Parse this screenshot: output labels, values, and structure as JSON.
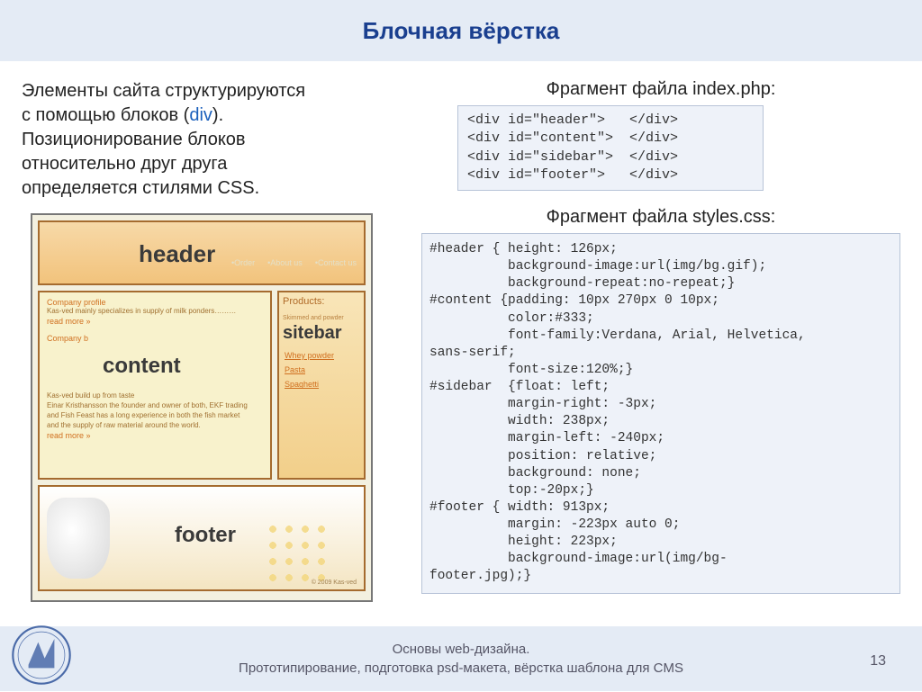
{
  "title": "Блочная вёрстка",
  "intro": {
    "line1": "Элементы сайта структурируются",
    "line2a": "с помощью блоков (",
    "div_word": "div",
    "line2b": ").",
    "line3": "Позиционирование блоков",
    "line4": "относительно друг друга",
    "line5": "определяется стилями CSS."
  },
  "mock": {
    "header_label": "header",
    "nav": [
      "•Order",
      "•About us",
      "•Contact us"
    ],
    "content_label": "content",
    "content_texts": {
      "cp": "Company profile",
      "l1": "Kas-ved mainly specializes in supply of milk ponders………",
      "rm": "read more »",
      "cb": "Company b",
      "l2": "Kas-ved build up from taste",
      "l3": "Einar Kristhansson the founder and owner of both, EKF trading",
      "l4": "and Fish Feast has a long experience in both the fish market",
      "l5": "and the supply of raw material around the world.",
      "rm2": "read more »"
    },
    "sidebar_label": "sitebar",
    "sidebar_title": "Products:",
    "sidebar_sub": "Skimmed and powder",
    "sidebar_links": [
      "Whey powder",
      "Pasta",
      "Spaghetti"
    ],
    "footer_label": "footer",
    "copyright": "© 2009 Kas-ved"
  },
  "php_caption": "Фрагмент файла index.php:",
  "php_code": "<div id=\"header\">   </div>\n<div id=\"content\">  </div>\n<div id=\"sidebar\">  </div>\n<div id=\"footer\">   </div>",
  "css_caption": "Фрагмент файла styles.css:",
  "css_code": "#header { height: 126px;\n          background-image:url(img/bg.gif);\n          background-repeat:no-repeat;}\n#content {padding: 10px 270px 0 10px;\n          color:#333;\n          font-family:Verdana, Arial, Helvetica,\nsans-serif;\n          font-size:120%;}\n#sidebar  {float: left;\n          margin-right: -3px;\n          width: 238px;\n          margin-left: -240px;\n          position: relative;\n          background: none;\n          top:-20px;}\n#footer { width: 913px;\n          margin: -223px auto 0;\n          height: 223px;\n          background-image:url(img/bg-\nfooter.jpg);}",
  "footer": {
    "line1": "Основы web-дизайна.",
    "line2": "Прототипирование, подготовка psd-макета, вёрстка шаблона для CMS"
  },
  "page_number": "13"
}
